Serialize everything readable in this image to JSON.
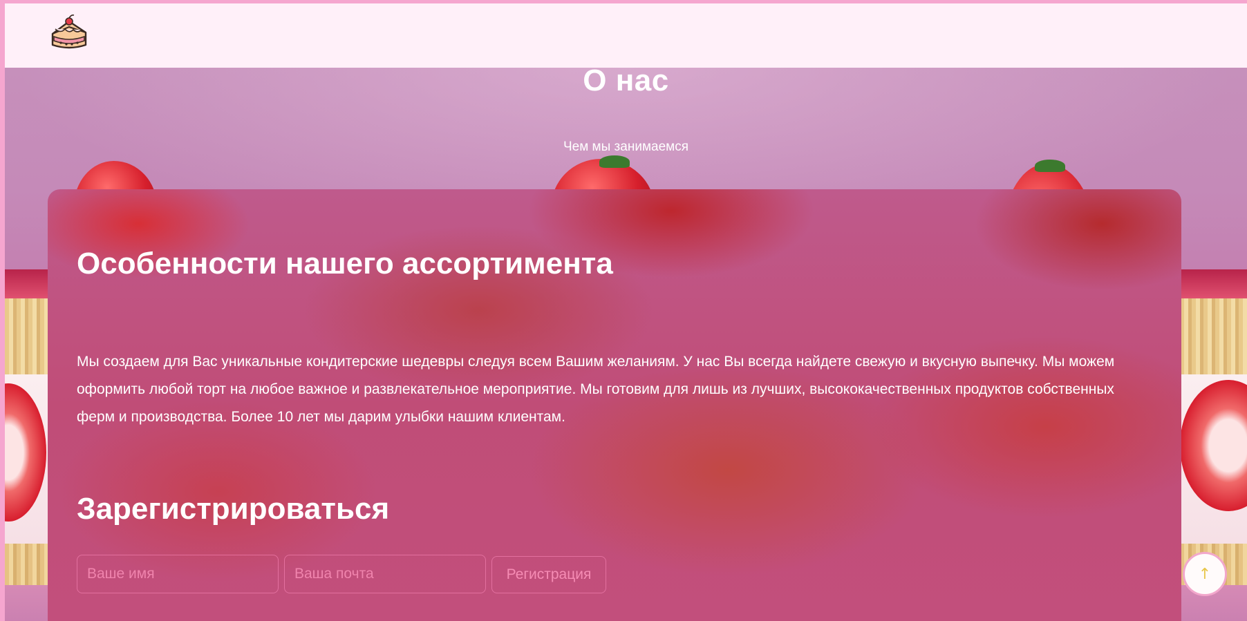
{
  "header": {
    "logo_icon": "cake-slice-icon"
  },
  "about": {
    "title": "О нас",
    "subtitle": "Чем мы занимаемся"
  },
  "card": {
    "heading": "Особенности нашего ассортимента",
    "text": "Мы создаем для Вас уникальные кондитерские шедевры следуя всем Вашим желаниям. У нас Вы всегда найдете свежую и вкусную выпечку. Мы можем оформить любой торт на любое важное и развлекательное мероприятие. Мы готовим для лишь из лучших, высококачественных продуктов собственных ферм и производства. Более 10 лет мы дарим улыбки нашим клиентам."
  },
  "register": {
    "heading": "Зарегистрироваться",
    "name_placeholder": "Ваше имя",
    "email_placeholder": "Ваша почта",
    "submit_label": "Регистрация"
  },
  "scroll_top": {
    "icon": "arrow-up-icon",
    "glyph": "↑"
  },
  "colors": {
    "page_border": "#f5a6cf",
    "header_bg": "#fff0f9",
    "card_accent": "#c04d77",
    "input_border": "#ff8cbe",
    "scroll_arrow": "#e8c64a"
  }
}
